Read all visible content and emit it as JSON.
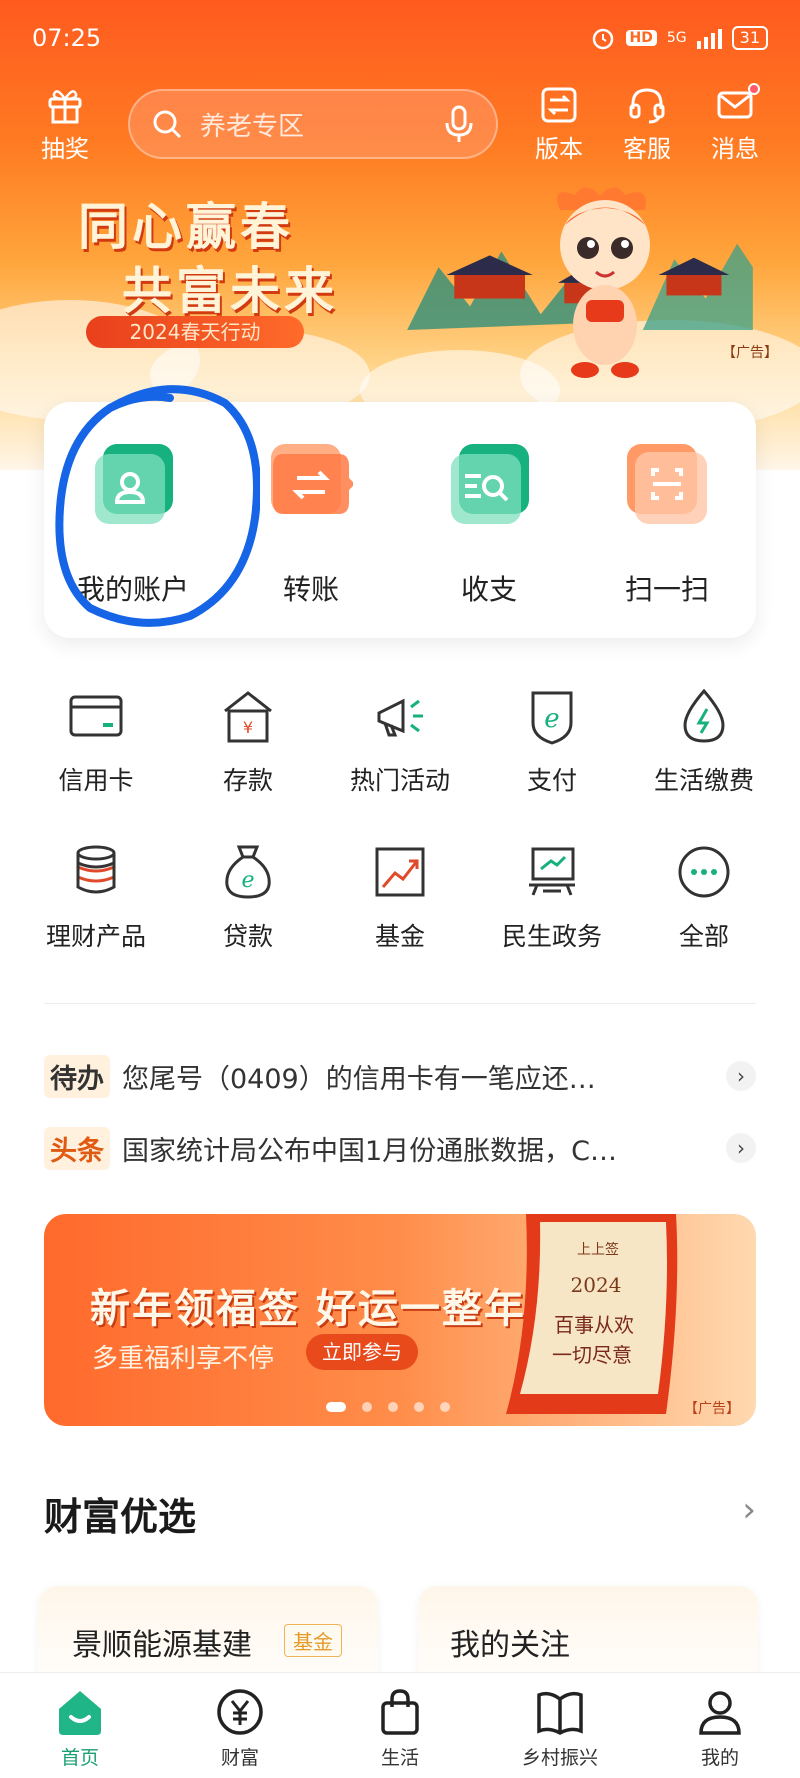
{
  "status_bar": {
    "time": "07:25",
    "network": "5G",
    "hd": "HD",
    "battery": "31"
  },
  "top_bar": {
    "lottery_label": "抽奖",
    "search_placeholder": "养老专区",
    "version_label": "版本",
    "service_label": "客服",
    "messages_label": "消息"
  },
  "banner": {
    "slogan_line1": "同心赢春",
    "slogan_line2": "共富未来",
    "campaign": "2024春天行动",
    "ad_tag": "【广告】"
  },
  "quick_actions": [
    {
      "label": "我的账户",
      "icon": "account-icon"
    },
    {
      "label": "转账",
      "icon": "transfer-icon"
    },
    {
      "label": "收支",
      "icon": "income-expense-icon"
    },
    {
      "label": "扫一扫",
      "icon": "scan-icon"
    }
  ],
  "services": [
    {
      "label": "信用卡",
      "icon": "credit-card-icon"
    },
    {
      "label": "存款",
      "icon": "deposit-icon"
    },
    {
      "label": "热门活动",
      "icon": "megaphone-icon"
    },
    {
      "label": "支付",
      "icon": "payment-icon"
    },
    {
      "label": "生活缴费",
      "icon": "utility-icon"
    },
    {
      "label": "理财产品",
      "icon": "coins-icon"
    },
    {
      "label": "贷款",
      "icon": "loan-bag-icon"
    },
    {
      "label": "基金",
      "icon": "fund-chart-icon"
    },
    {
      "label": "民生政务",
      "icon": "government-icon"
    },
    {
      "label": "全部",
      "icon": "more-icon"
    }
  ],
  "notices": [
    {
      "tag": "待办",
      "text": "您尾号（0409）的信用卡有一笔应还…"
    },
    {
      "tag": "头条",
      "text": "国家统计局公布中国1月份通胀数据，C…"
    }
  ],
  "promo": {
    "title": "新年领福签 好运一整年",
    "subtitle": "多重福利享不停",
    "cta": "立即参与",
    "scroll_top": "上上签",
    "scroll_year": "2024",
    "scroll_line1": "百事从欢",
    "scroll_line2": "一切尽意",
    "ad_tag": "【广告】"
  },
  "wealth": {
    "title": "财富优选",
    "card1_title": "景顺能源基建",
    "card1_tag": "基金",
    "card2_title": "我的关注"
  },
  "tabs": [
    {
      "label": "首页",
      "active": true
    },
    {
      "label": "财富"
    },
    {
      "label": "生活"
    },
    {
      "label": "乡村振兴"
    },
    {
      "label": "我的"
    }
  ],
  "colors": {
    "brand_green": "#1a9e72",
    "header_orange": "#ff5a1f",
    "annotation_blue": "#1565e6"
  }
}
